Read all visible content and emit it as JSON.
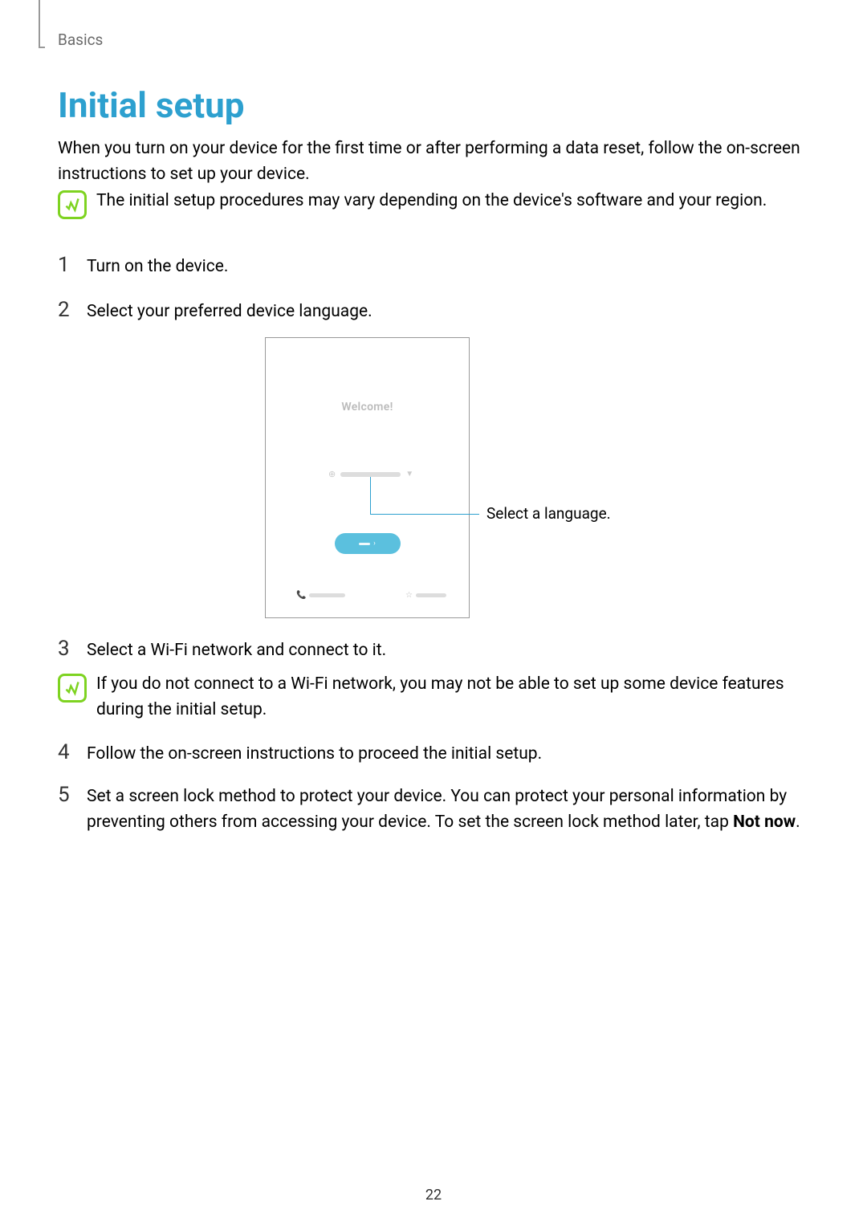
{
  "breadcrumb": "Basics",
  "title": "Initial setup",
  "intro": "When you turn on your device for the first time or after performing a data reset, follow the on-screen instructions to set up your device.",
  "note1": "The initial setup procedures may vary depending on the device's software and your region.",
  "steps": {
    "s1_num": "1",
    "s1_text": "Turn on the device.",
    "s2_num": "2",
    "s2_text": "Select your preferred device language.",
    "s3_num": "3",
    "s3_text": "Select a Wi-Fi network and connect to it.",
    "s4_num": "4",
    "s4_text": "Follow the on-screen instructions to proceed the initial setup.",
    "s5_num": "5",
    "s5_text_a": "Set a screen lock method to protect your device. You can protect your personal information by preventing others from accessing your device. To set the screen lock method later, tap ",
    "s5_text_b": "Not now",
    "s5_text_c": "."
  },
  "note2": "If you do not connect to a Wi-Fi network, you may not be able to set up some device features during the initial setup.",
  "phone": {
    "welcome": "Welcome!"
  },
  "callout": "Select a language.",
  "pageNumber": "22"
}
